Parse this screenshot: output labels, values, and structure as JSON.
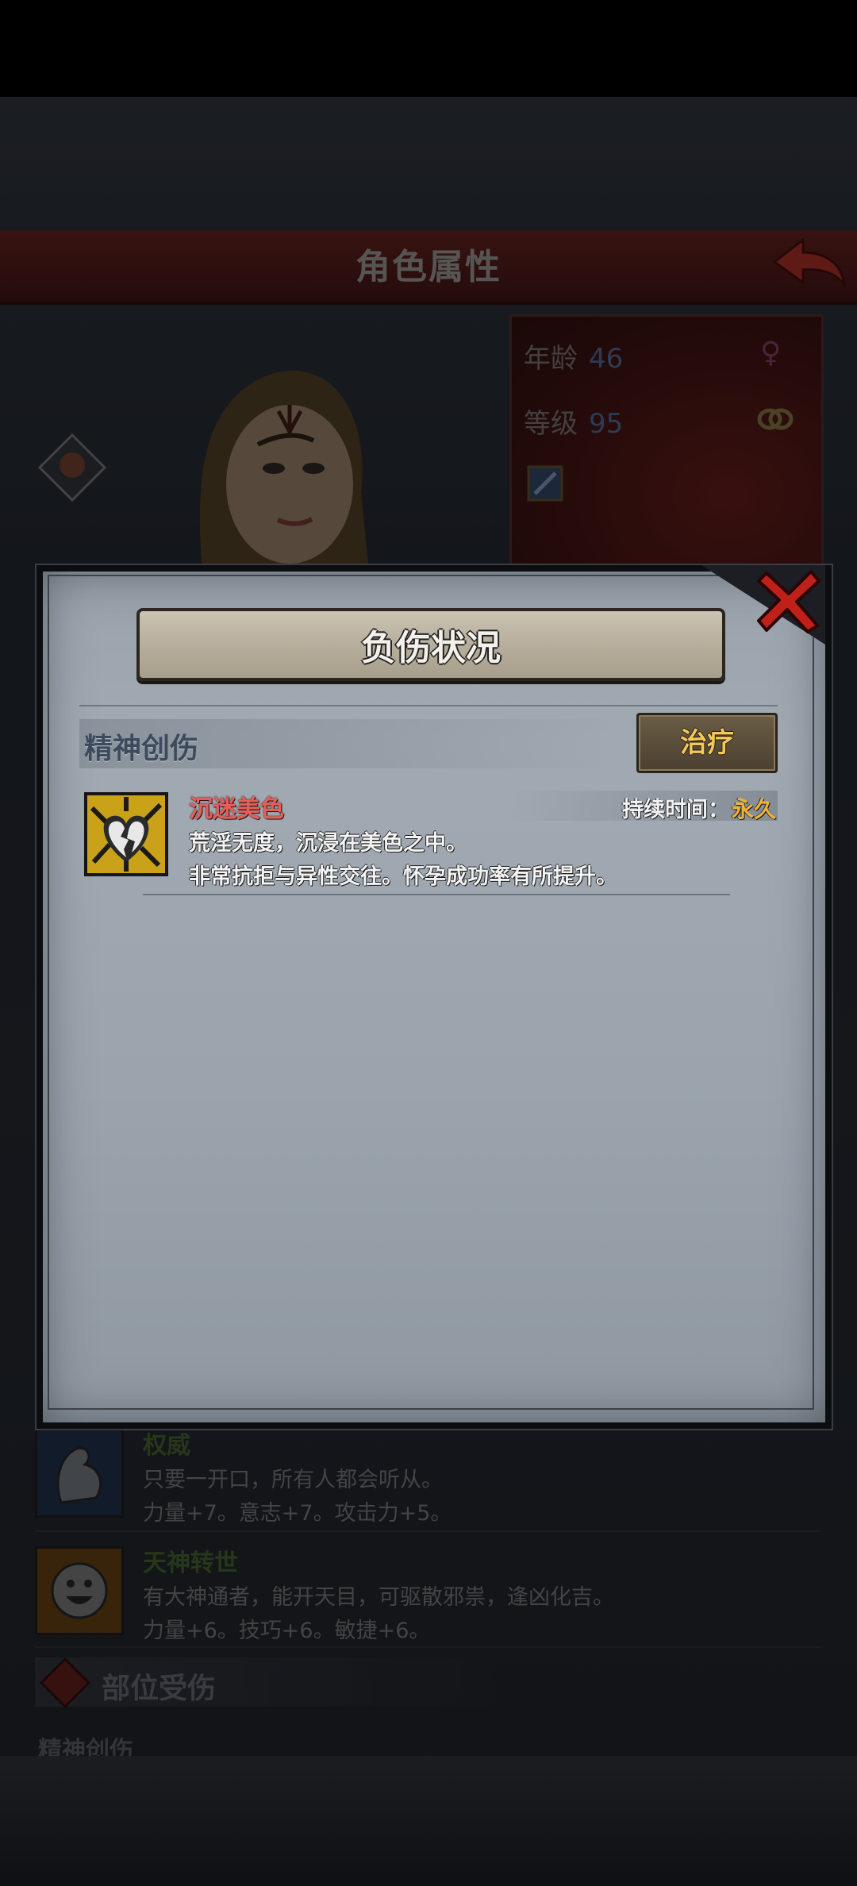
{
  "background_screen": {
    "header": {
      "title": "角色属性"
    },
    "info": {
      "age_label": "年龄",
      "age_value": "46",
      "level_label": "等级",
      "level_value": "95"
    },
    "traits": [
      {
        "name": "权威",
        "desc": "只要一开口，所有人都会听从。",
        "effect": "力量+7。意志+7。攻击力+5。"
      },
      {
        "name": "天神转世",
        "desc": "有大神通者，能开天目，可驱散邪祟，逢凶化吉。",
        "effect": "力量+6。技巧+6。敏捷+6。"
      }
    ],
    "section_title": "部位受伤",
    "cut_label": "精神创伤"
  },
  "dialog": {
    "title": "负伤状况",
    "section_title": "精神创伤",
    "treat_label": "治疗",
    "injury": {
      "name": "沉迷美色",
      "duration_label": "持续时间：",
      "duration_value": "永久",
      "desc_line1": "荒淫无度，沉浸在美色之中。",
      "desc_line2": "非常抗拒与异性交往。怀孕成功率有所提升。"
    }
  },
  "colors": {
    "header_red": "#5a1f1c",
    "treat_text": "#f6c85a",
    "injury_name": "#e3605a",
    "duration_value": "#f0b23a"
  },
  "icons": [
    "back-arrow-icon",
    "female-icon",
    "rings-icon",
    "weapon-icon",
    "rank-badge-icon",
    "close-icon",
    "broken-heart-icon",
    "flexed-arm-icon",
    "smiley-icon",
    "injury-diamond-icon"
  ]
}
